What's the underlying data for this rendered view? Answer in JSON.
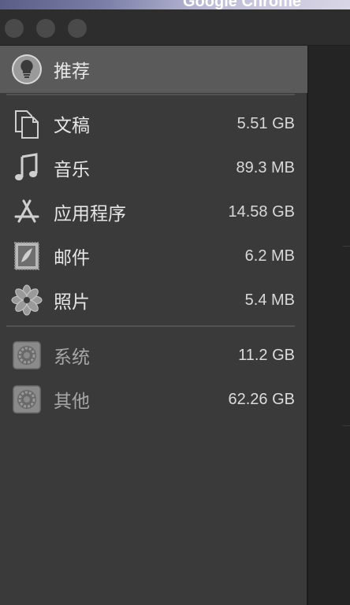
{
  "window": {
    "app_title": "Google Chrome"
  },
  "sidebar": {
    "items": [
      {
        "label": "推荐",
        "size": "",
        "icon": "lightbulb-icon"
      },
      {
        "label": "文稿",
        "size": "5.51 GB",
        "icon": "documents-icon"
      },
      {
        "label": "音乐",
        "size": "89.3 MB",
        "icon": "music-note-icon"
      },
      {
        "label": "应用程序",
        "size": "14.58 GB",
        "icon": "app-store-icon"
      },
      {
        "label": "邮件",
        "size": "6.2 MB",
        "icon": "mail-stamp-icon"
      },
      {
        "label": "照片",
        "size": "5.4 MB",
        "icon": "photos-icon"
      },
      {
        "label": "系统",
        "size": "11.2 GB",
        "icon": "system-disk-icon"
      },
      {
        "label": "其他",
        "size": "62.26 GB",
        "icon": "other-disk-icon"
      }
    ]
  },
  "colors": {
    "sidebar_bg": "#3a3a3a",
    "selected_bg": "#5a5a5a",
    "text": "#e6e6e6",
    "dim_text": "#a6a6a6"
  }
}
